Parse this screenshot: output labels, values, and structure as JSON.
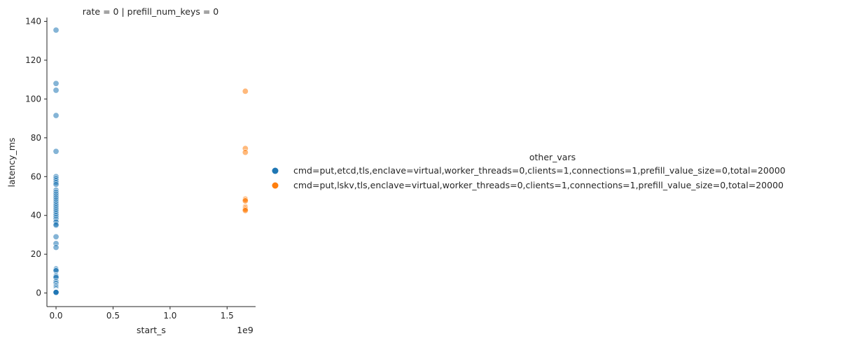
{
  "chart_data": {
    "type": "scatter",
    "title": "rate = 0 | prefill_num_keys = 0",
    "xlabel": "start_s",
    "ylabel": "latency_ms",
    "x_offset_label": "1e9",
    "xlim": [
      -0.08,
      1.75
    ],
    "ylim": [
      -7,
      142
    ],
    "x_ticks": [
      0,
      0.5,
      1.0,
      1.5
    ],
    "x_tick_labels": [
      "0.0",
      "0.5",
      "1.0",
      "1.5"
    ],
    "y_ticks": [
      0,
      20,
      40,
      60,
      80,
      100,
      120,
      140
    ],
    "y_tick_labels": [
      "0",
      "20",
      "40",
      "60",
      "80",
      "100",
      "120",
      "140"
    ],
    "grid": false,
    "legend": {
      "title": "other_vars",
      "placement": "right"
    },
    "series": [
      {
        "name": "cmd=put,etcd,tls,enclave=virtual,worker_threads=0,clients=1,connections=1,prefill_value_size=0,total=20000",
        "color": "#1f77b4",
        "x": [
          0,
          0,
          0,
          0,
          0,
          0,
          0,
          0,
          0,
          0,
          0,
          0,
          0,
          0,
          0,
          0,
          0,
          0,
          0,
          0,
          0,
          0,
          0,
          0,
          0,
          0,
          0,
          0,
          0,
          0,
          0,
          0,
          0,
          0,
          0,
          0,
          0,
          0,
          0,
          0,
          0,
          0,
          0,
          0,
          0,
          0,
          0,
          0,
          0,
          0,
          0,
          0,
          0,
          0,
          0
        ],
        "y": [
          135.5,
          108,
          104.5,
          91.5,
          73,
          60,
          59,
          58,
          57,
          56,
          53,
          52,
          51,
          50,
          49,
          48,
          47,
          46,
          45,
          44,
          43,
          42,
          41,
          40,
          39,
          38,
          37,
          36.5,
          35.5,
          35,
          29,
          25.5,
          23.5,
          12.5,
          12,
          11.5,
          9,
          8.5,
          8,
          6,
          5,
          4,
          3.5,
          3,
          2.5,
          2,
          1.5,
          1.2,
          1,
          0.9,
          0.8,
          0.6,
          0.5,
          0.4,
          0.3
        ]
      },
      {
        "name": "cmd=put,lskv,tls,enclave=virtual,worker_threads=0,clients=1,connections=1,prefill_value_size=0,total=20000",
        "color": "#ff7f0e",
        "x": [
          1.66,
          1.66,
          1.66,
          1.66,
          1.66,
          1.66,
          1.66,
          1.66,
          1.66,
          1.66,
          1.66
        ],
        "y": [
          104,
          74.5,
          72.5,
          48.5,
          48,
          47.5,
          44.5,
          44,
          43.5,
          43,
          42.5
        ]
      }
    ]
  }
}
